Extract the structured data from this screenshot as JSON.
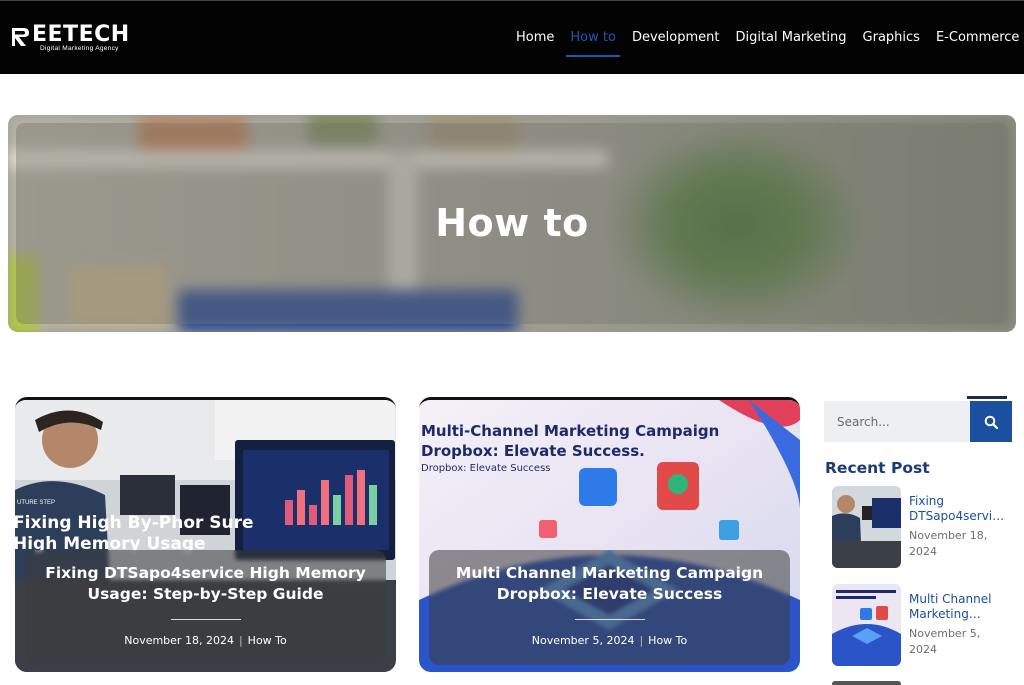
{
  "brand": {
    "name": "EETECH",
    "tagline": "Digital Marketing Agency"
  },
  "nav": {
    "items": [
      {
        "label": "Home",
        "active": false
      },
      {
        "label": "How to",
        "active": true
      },
      {
        "label": "Development",
        "active": false
      },
      {
        "label": "Digital Marketing",
        "active": false
      },
      {
        "label": "Graphics",
        "active": false
      },
      {
        "label": "E-Commerce",
        "active": false
      }
    ]
  },
  "hero": {
    "title": "How to"
  },
  "posts": [
    {
      "title": "Fixing DTSapo4service High Memory Usage: Step-by-Step Guide",
      "date": "November 18, 2024",
      "category": "How To",
      "image_text": [
        "Fixing High By-Phor Sure",
        "High Memory Usage",
        "UTURE STEP"
      ]
    },
    {
      "title": "Multi Channel Marketing Campaign Dropbox: Elevate Success",
      "date": "November 5, 2024",
      "category": "How To",
      "image_text": [
        "Multi-Channel Marketing Campaign",
        "Dropbox: Elevate Success.",
        "Dropbox: Elevate Success"
      ]
    }
  ],
  "sidebar": {
    "search_placeholder": "Search...",
    "recent_title": "Recent Post",
    "recent": [
      {
        "title": "Fixing DTSapo4servi…",
        "date": "November 18, 2024"
      },
      {
        "title": "Multi Channel Marketing…",
        "date": "November 5, 2024"
      }
    ]
  },
  "colors": {
    "header_bg": "#030303",
    "accent": "#1e56b8",
    "search_button": "#1b4fa0",
    "recent_heading": "#1b3a78"
  },
  "icons": {
    "search": "search-icon"
  }
}
